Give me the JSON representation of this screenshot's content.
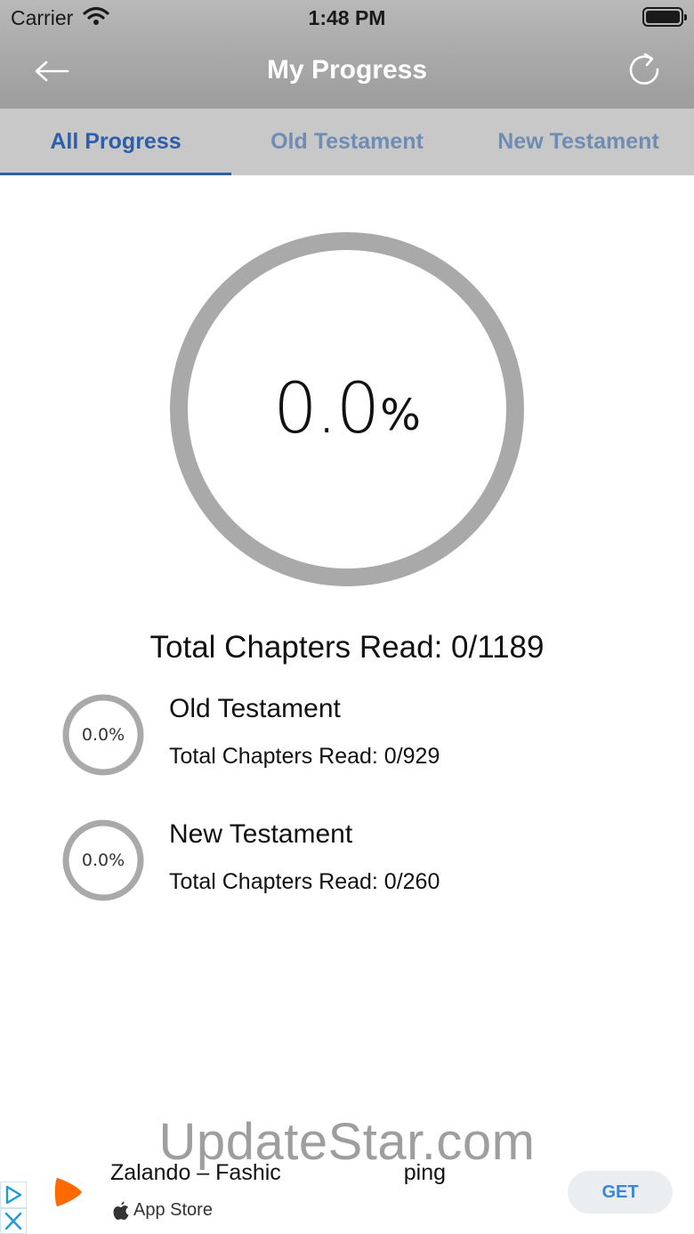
{
  "status_bar": {
    "carrier": "Carrier",
    "time": "1:48 PM"
  },
  "nav": {
    "title": "My Progress",
    "back_icon": "arrow-left-icon",
    "refresh_icon": "refresh-icon"
  },
  "tabs": [
    {
      "label": "All Progress",
      "active": true
    },
    {
      "label": "Old Testament",
      "active": false
    },
    {
      "label": "New Testament",
      "active": false
    }
  ],
  "overall": {
    "percent_number": "0.0",
    "percent_sign": "%",
    "progress": 0.0,
    "total_label": "Total Chapters Read: 0/1189"
  },
  "sections": [
    {
      "percent": "0.0%",
      "progress": 0.0,
      "title": "Old Testament",
      "subtitle": "Total Chapters Read: 0/929"
    },
    {
      "percent": "0.0%",
      "progress": 0.0,
      "title": "New Testament",
      "subtitle": "Total Chapters Read: 0/260"
    }
  ],
  "watermark": "UpdateStar.com",
  "ad": {
    "title_left": "Zalando – Fashic",
    "title_right": "ping",
    "store": "App Store",
    "cta": "GET"
  },
  "colors": {
    "accent": "#2f5ea8",
    "tab_inactive": "#6f8db4",
    "ring": "#a9a9a9",
    "header": "#acacac",
    "ad_brand": "#ff6900"
  }
}
